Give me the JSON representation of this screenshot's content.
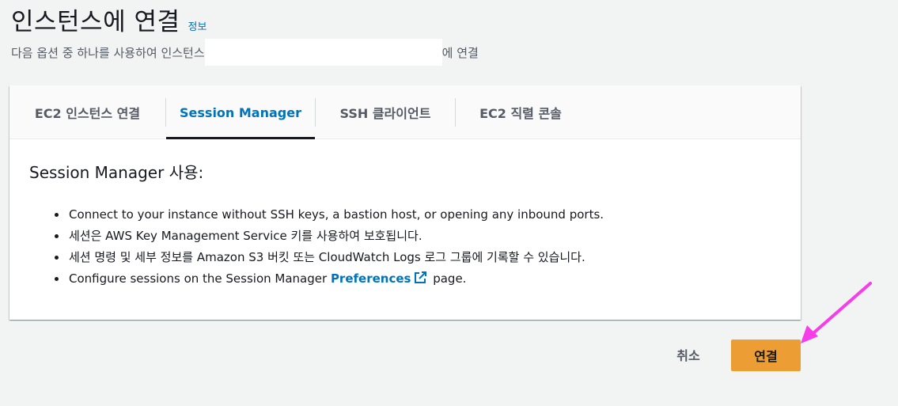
{
  "header": {
    "title": "인스턴스에 연결",
    "info_link": "정보",
    "subtitle_prefix": "다음 옵션 중 하나를 사용하여 인스턴스",
    "subtitle_suffix": "에 연결"
  },
  "tabs": [
    {
      "label": "EC2 인스턴스 연결",
      "active": false
    },
    {
      "label": "Session Manager",
      "active": true
    },
    {
      "label": "SSH 클라이언트",
      "active": false
    },
    {
      "label": "EC2 직렬 콘솔",
      "active": false
    }
  ],
  "content": {
    "heading": "Session Manager 사용:",
    "bullets": [
      "Connect to your instance without SSH keys, a bastion host, or opening any inbound ports.",
      "세션은 AWS Key Management Service 키를 사용하여 보호됩니다.",
      "세션 명령 및 세부 정보를 Amazon S3 버킷 또는 CloudWatch Logs 로그 그룹에 기록할 수 있습니다."
    ],
    "last_bullet": {
      "prefix": "Configure sessions on the Session Manager ",
      "link": "Preferences",
      "suffix": " page."
    }
  },
  "footer": {
    "cancel_label": "취소",
    "connect_label": "연결"
  },
  "colors": {
    "accent_link": "#0073bb",
    "primary_button": "#ec9d34",
    "annotation_arrow": "#f53de8"
  },
  "icons": {
    "external_link": "external-link-icon",
    "annotation": "pointer-arrow-icon"
  }
}
